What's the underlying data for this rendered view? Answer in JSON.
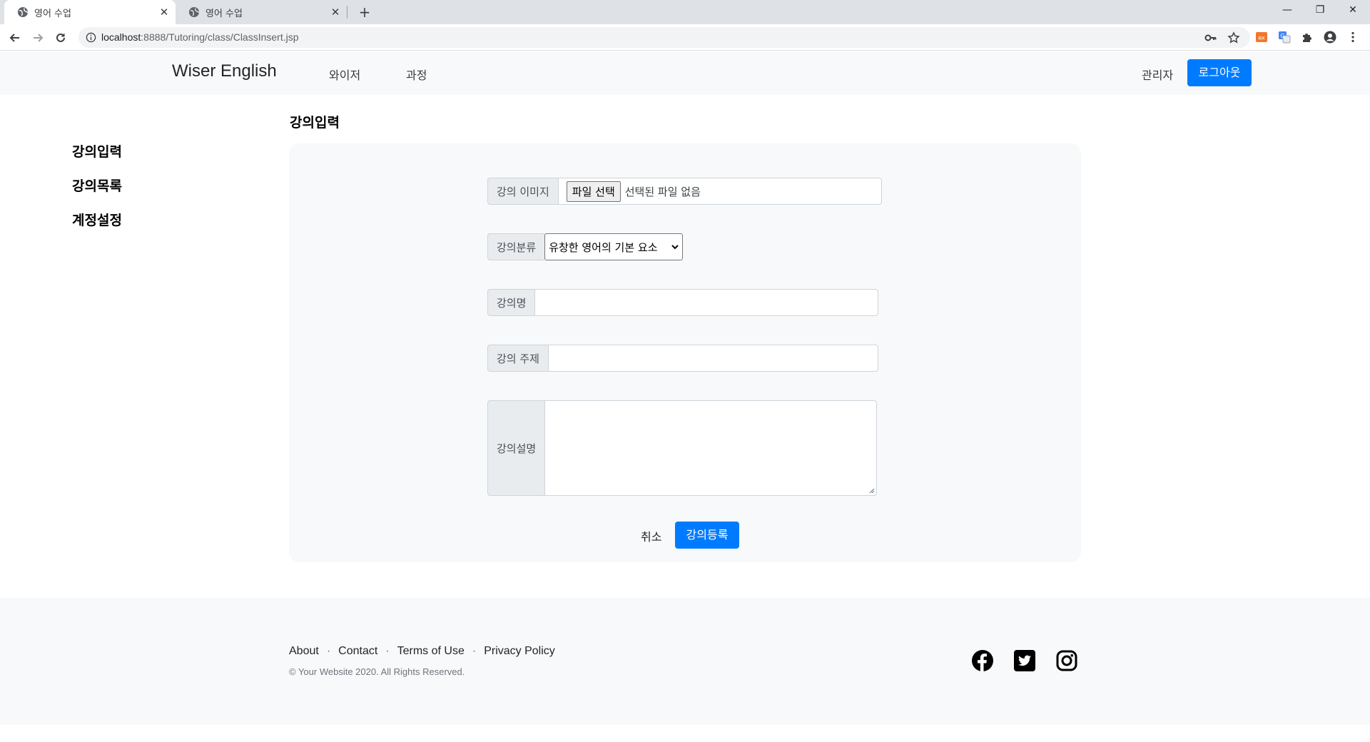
{
  "browser": {
    "tabs": [
      {
        "title": "영어 수업",
        "active": true
      },
      {
        "title": "영어 수업",
        "active": false
      }
    ],
    "url_host": "localhost",
    "url_path": ":8888/Tutoring/class/ClassInsert.jsp"
  },
  "navbar": {
    "brand": "Wiser English",
    "links": [
      "와이저",
      "과정"
    ],
    "admin": "관리자",
    "logout": "로그아웃"
  },
  "sidebar": {
    "items": [
      "강의입력",
      "강의목록",
      "계정설정"
    ]
  },
  "page": {
    "title": "강의입력"
  },
  "form": {
    "image_label": "강의 이미지",
    "file_button": "파일 선택",
    "file_status": "선택된 파일 없음",
    "category_label": "강의분류",
    "category_selected": "유창한 영어의 기본 요소",
    "name_label": "강의명",
    "name_value": "",
    "topic_label": "강의 주제",
    "topic_value": "",
    "description_label": "강의설명",
    "description_value": "",
    "cancel": "취소",
    "submit": "강의등록"
  },
  "footer": {
    "links": [
      "About",
      "Contact",
      "Terms of Use",
      "Privacy Policy"
    ],
    "copyright": "© Your Website 2020. All Rights Reserved.",
    "social": [
      "facebook-icon",
      "twitter-icon",
      "instagram-icon"
    ]
  },
  "colors": {
    "primary": "#007bff",
    "panel_bg": "#f8f9fa"
  }
}
